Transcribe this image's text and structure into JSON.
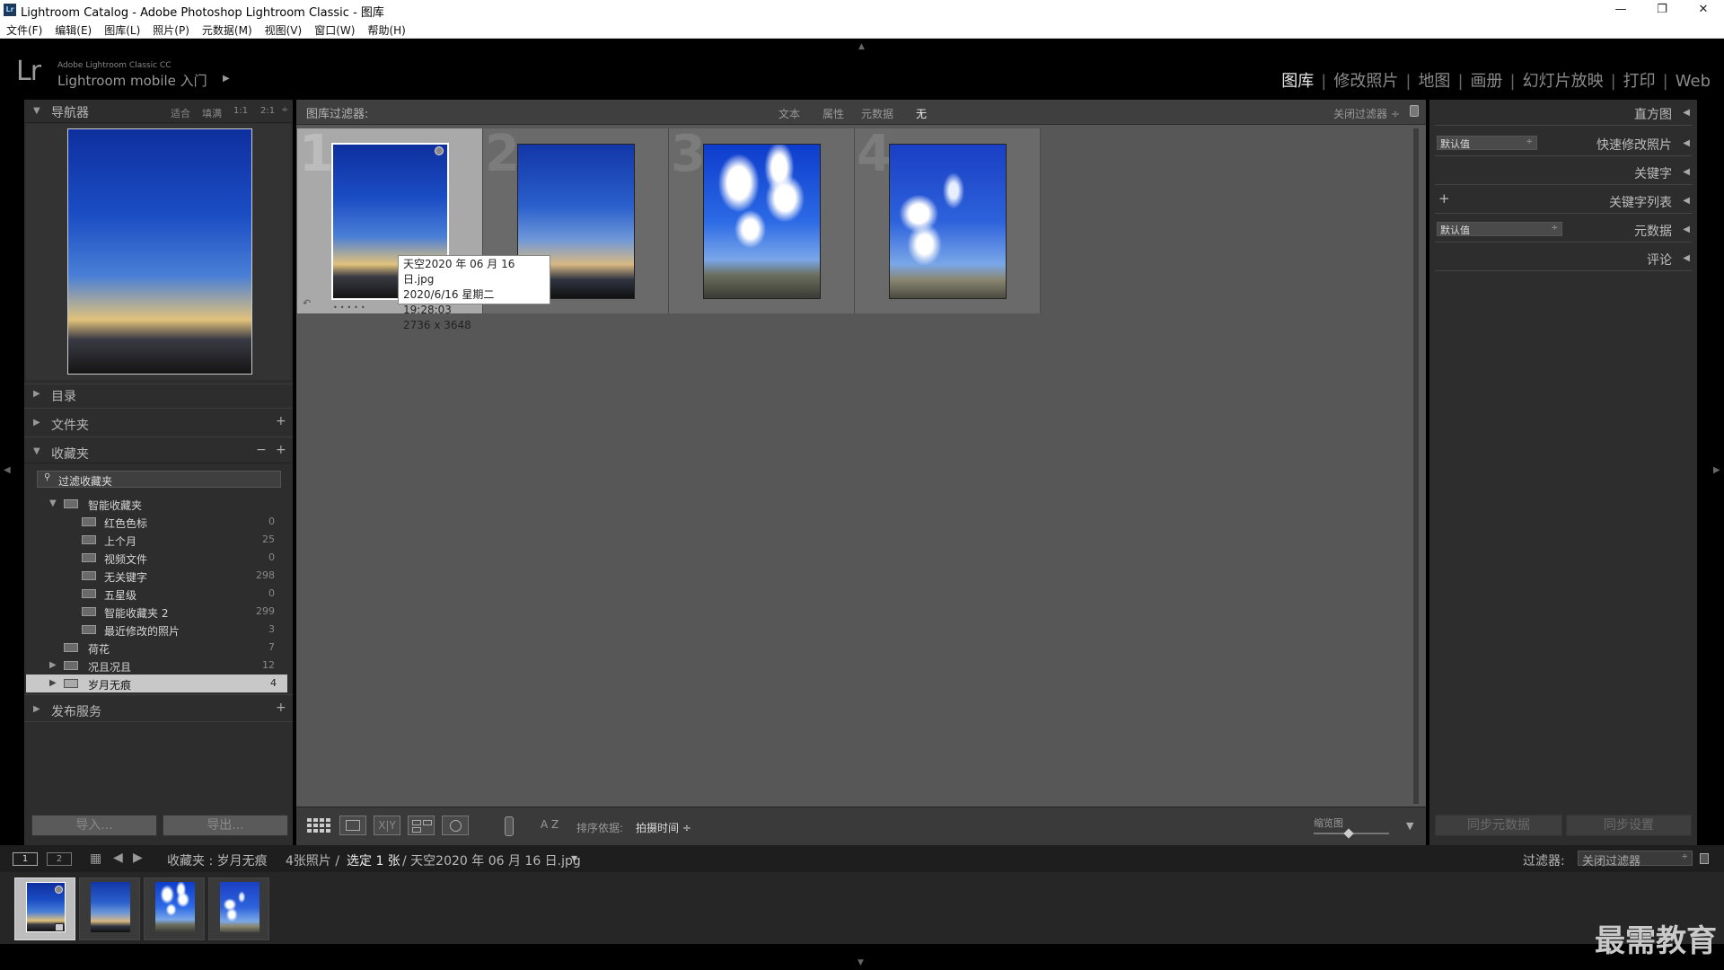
{
  "window": {
    "title": "Lightroom Catalog - Adobe Photoshop Lightroom Classic - 图库",
    "icon": "Lr",
    "controls": {
      "minimize": "—",
      "restore": "❐",
      "close": "✕"
    }
  },
  "menu": [
    "文件(F)",
    "编辑(E)",
    "图库(L)",
    "照片(P)",
    "元数据(M)",
    "视图(V)",
    "窗口(W)",
    "帮助(H)"
  ],
  "identity": {
    "logo": "Lr",
    "product": "Adobe Lightroom Classic CC",
    "mobile": "Lightroom mobile 入门",
    "arrow": "▶"
  },
  "modules": {
    "items": [
      "图库",
      "修改照片",
      "地图",
      "画册",
      "幻灯片放映",
      "打印",
      "Web"
    ],
    "active": "图库",
    "separator": "|"
  },
  "navigator": {
    "title": "导航器",
    "zoom": [
      "适合",
      "填满",
      "1:1",
      "2:1"
    ],
    "zoom_arrow": "÷"
  },
  "left_sections": {
    "catalog": "目录",
    "folders": "文件夹",
    "collections": "收藏夹",
    "publish": "发布服务",
    "plus": "+",
    "minus": "−"
  },
  "collections": {
    "filter_placeholder": "过滤收藏夹",
    "smart_group": "智能收藏夹",
    "items": [
      {
        "label": "红色色标",
        "count": "0"
      },
      {
        "label": "上个月",
        "count": "25"
      },
      {
        "label": "视频文件",
        "count": "0"
      },
      {
        "label": "无关键字",
        "count": "298"
      },
      {
        "label": "五星级",
        "count": "0"
      },
      {
        "label": "智能收藏夹 2",
        "count": "299"
      },
      {
        "label": "最近修改的照片",
        "count": "3"
      }
    ],
    "others": [
      {
        "label": "荷花",
        "count": "7"
      },
      {
        "label": "况且况且",
        "count": "12"
      },
      {
        "label": "岁月无痕",
        "count": "4"
      }
    ]
  },
  "left_buttons": {
    "import": "导入...",
    "export": "导出..."
  },
  "filter_bar": {
    "label": "图库过滤器:",
    "options": [
      "文本",
      "属性",
      "元数据",
      "无"
    ],
    "active": "无",
    "off": "关闭过滤器 ÷"
  },
  "grid": {
    "numbers": [
      "1",
      "2",
      "3",
      "4"
    ],
    "selected_index": 0
  },
  "tooltip": {
    "line1": "天空2020 年 06 月 16 日.jpg",
    "line2": "2020/6/16 星期二 19:28:03",
    "line3": "2736 x 3648"
  },
  "toolbar": {
    "sort_label": "排序依据:",
    "sort_value": "拍摄时间 ÷",
    "thumb_label": "缩览图",
    "az": "A Z",
    "xy": "X|Y"
  },
  "right_panel": {
    "histogram": "直方图",
    "quick_develop": "快速修改照片",
    "quick_value": "默认值",
    "keywording": "关键字",
    "keyword_list": "关键字列表",
    "metadata": "元数据",
    "metadata_value": "默认值",
    "comments": "评论",
    "sync_metadata": "同步元数据",
    "sync_settings": "同步设置",
    "triangle": "◀"
  },
  "filmstrip_bar": {
    "view1": "1",
    "view2": "2",
    "source": "收藏夹 : 岁月无痕",
    "count": "4张照片 /",
    "selected": "选定 1 张",
    "file": "/ 天空2020 年 06 月 16 日.jpg",
    "dropdown_arrow": "▾",
    "filter_label": "过滤器:",
    "filter_value": "关闭过滤器"
  },
  "watermark": "最需教育",
  "colors": {
    "panel": "#2d2d2d",
    "center": "#575757",
    "selected_cell": "#a9a9a9",
    "module_active": "#e8e8e8"
  }
}
